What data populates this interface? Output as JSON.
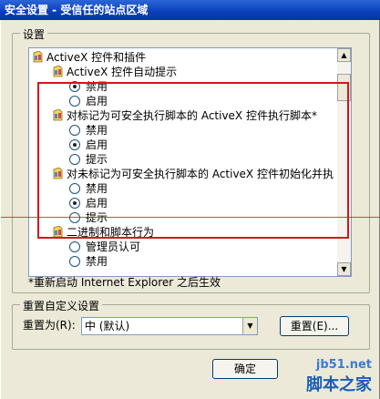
{
  "window": {
    "title": "安全设置 - 受信任的站点区域"
  },
  "settings_group": {
    "label": "设置"
  },
  "tree": [
    {
      "type": "category",
      "label": "ActiveX 控件和插件"
    },
    {
      "type": "setting",
      "label": "ActiveX 控件自动提示"
    },
    {
      "type": "option",
      "label": "禁用",
      "selected": true
    },
    {
      "type": "option",
      "label": "启用",
      "selected": false
    },
    {
      "type": "setting",
      "label": "对标记为可安全执行脚本的 ActiveX 控件执行脚本*"
    },
    {
      "type": "option",
      "label": "禁用",
      "selected": false
    },
    {
      "type": "option",
      "label": "启用",
      "selected": true
    },
    {
      "type": "option",
      "label": "提示",
      "selected": false
    },
    {
      "type": "setting",
      "label": "对未标记为可安全执行脚本的 ActiveX 控件初始化并执"
    },
    {
      "type": "option",
      "label": "禁用",
      "selected": false
    },
    {
      "type": "option",
      "label": "启用",
      "selected": true
    },
    {
      "type": "option",
      "label": "提示",
      "selected": false
    },
    {
      "type": "category",
      "label": "二进制和脚本行为"
    },
    {
      "type": "option",
      "label": "管理员认可",
      "selected": false
    },
    {
      "type": "option",
      "label": "禁用",
      "selected": false
    }
  ],
  "scrollbar": {
    "up": "▲",
    "down": "▼",
    "left": "◀",
    "right": "▶"
  },
  "note": "*重新启动 Internet Explorer 之后生效",
  "reset_group": {
    "label": "重置自定义设置"
  },
  "reset_to": {
    "label": "重置为(R):",
    "value": "中 (默认)",
    "arrow": "▼"
  },
  "reset_button": {
    "label": "重置(E)..."
  },
  "ok_button": {
    "label": "确定"
  },
  "watermark": {
    "line1": "jb51.net",
    "line2": "脚本之家"
  },
  "colors": {
    "highlight": "#d8141c",
    "title_bar": "#0a3fb8"
  }
}
